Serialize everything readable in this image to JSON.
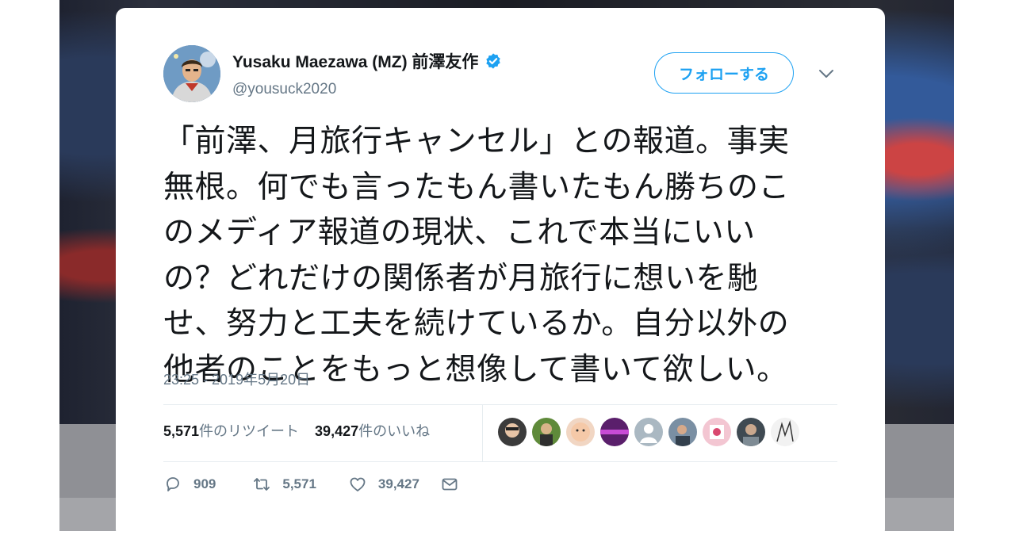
{
  "user": {
    "display_name": "Yusaku Maezawa (MZ) 前澤友作",
    "handle": "@yousuck2020"
  },
  "follow_label": "フォローする",
  "tweet_lines": [
    "「前澤、月旅行キャンセル」との報道。事実",
    "無根。何でも言ったもん書いたもん勝ちのこ",
    "のメディア報道の現状、これで本当にいい",
    "の？どれだけの関係者が月旅行に想いを馳",
    "せ、努力と工夫を続けているか。自分以外の",
    "他者のことをもっと想像して書いて欲しい。"
  ],
  "timestamp": "23:25 - 2019年5月20日",
  "stats": {
    "retweets_count": "5,571",
    "retweets_label": "件のリツイート",
    "likes_count": "39,427",
    "likes_label": "件のいいね"
  },
  "actions": {
    "replies": "909",
    "retweets": "5,571",
    "likes": "39,427"
  },
  "colors": {
    "accent": "#1da1f2",
    "text": "#14171a",
    "muted": "#657786"
  },
  "icons": [
    "verified-badge-icon",
    "chevron-down-icon",
    "reply-icon",
    "retweet-icon",
    "like-icon",
    "message-icon"
  ]
}
